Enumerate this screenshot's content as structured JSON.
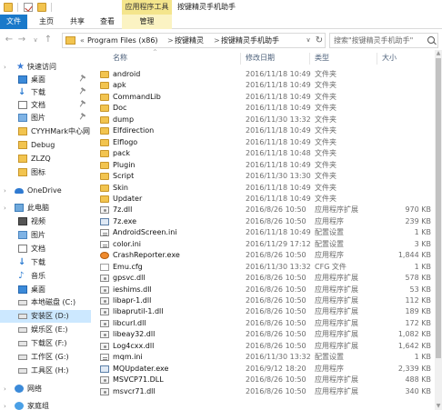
{
  "titlebar": {
    "context_tab": "应用程序工具",
    "title": "按键精灵手机助手"
  },
  "ribbon": {
    "tabs": [
      "文件",
      "主页",
      "共享",
      "查看",
      "管理"
    ]
  },
  "address": {
    "overflow": "«",
    "crumbs": [
      "Program Files (x86)",
      "按键精灵",
      "按键精灵手机助手"
    ],
    "separator": ">",
    "search_placeholder": "搜索\"按键精灵手机助手\""
  },
  "nav": {
    "items": [
      {
        "label": "快速访问",
        "icon": "star-icon",
        "pinned": false
      },
      {
        "label": "桌面",
        "icon": "desktop-icon",
        "pinned": true
      },
      {
        "label": "下载",
        "icon": "download-icon",
        "pinned": true
      },
      {
        "label": "文档",
        "icon": "documents-icon",
        "pinned": true
      },
      {
        "label": "图片",
        "icon": "pictures-icon",
        "pinned": true
      },
      {
        "label": "CYYHMark中心网",
        "icon": "folder-icon",
        "pinned": false
      },
      {
        "label": "Debug",
        "icon": "folder-icon",
        "pinned": false
      },
      {
        "label": "ZLZQ",
        "icon": "folder-icon",
        "pinned": false
      },
      {
        "label": "图标",
        "icon": "folder-icon",
        "pinned": false
      },
      {
        "label": "OneDrive",
        "icon": "cloud-icon",
        "pinned": false
      },
      {
        "label": "此电脑",
        "icon": "computer-icon",
        "pinned": false
      },
      {
        "label": "视频",
        "icon": "video-icon",
        "pinned": false
      },
      {
        "label": "图片",
        "icon": "pictures-icon",
        "pinned": false
      },
      {
        "label": "文档",
        "icon": "documents-icon",
        "pinned": false
      },
      {
        "label": "下载",
        "icon": "download-icon",
        "pinned": false
      },
      {
        "label": "音乐",
        "icon": "music-icon",
        "pinned": false
      },
      {
        "label": "桌面",
        "icon": "desktop-icon",
        "pinned": false
      },
      {
        "label": "本地磁盘 (C:)",
        "icon": "drive-icon",
        "pinned": false
      },
      {
        "label": "安装区 (D:)",
        "icon": "drive-icon",
        "pinned": false,
        "selected": true
      },
      {
        "label": "娱乐区 (E:)",
        "icon": "drive-icon",
        "pinned": false
      },
      {
        "label": "下载区 (F:)",
        "icon": "drive-icon",
        "pinned": false
      },
      {
        "label": "工作区 (G:)",
        "icon": "drive-icon",
        "pinned": false
      },
      {
        "label": "工具区 (H:)",
        "icon": "drive-icon",
        "pinned": false
      },
      {
        "label": "网络",
        "icon": "network-icon",
        "pinned": false
      },
      {
        "label": "家庭组",
        "icon": "homegroup-icon",
        "pinned": false
      }
    ]
  },
  "filelist": {
    "columns": {
      "name": "名称",
      "date": "修改日期",
      "type": "类型",
      "size": "大小"
    },
    "sort_indicator": "^",
    "rows": [
      {
        "name": "android",
        "date": "2016/11/18 10:49",
        "type": "文件夹",
        "size": "",
        "kind": "folder"
      },
      {
        "name": "apk",
        "date": "2016/11/18 10:49",
        "type": "文件夹",
        "size": "",
        "kind": "folder"
      },
      {
        "name": "CommandLib",
        "date": "2016/11/18 10:49",
        "type": "文件夹",
        "size": "",
        "kind": "folder"
      },
      {
        "name": "Doc",
        "date": "2016/11/18 10:49",
        "type": "文件夹",
        "size": "",
        "kind": "folder"
      },
      {
        "name": "dump",
        "date": "2016/11/30 13:32",
        "type": "文件夹",
        "size": "",
        "kind": "folder"
      },
      {
        "name": "Elfdirection",
        "date": "2016/11/18 10:49",
        "type": "文件夹",
        "size": "",
        "kind": "folder"
      },
      {
        "name": "Elflogo",
        "date": "2016/11/18 10:49",
        "type": "文件夹",
        "size": "",
        "kind": "folder"
      },
      {
        "name": "pack",
        "date": "2016/11/18 10:48",
        "type": "文件夹",
        "size": "",
        "kind": "folder"
      },
      {
        "name": "Plugin",
        "date": "2016/11/18 10:49",
        "type": "文件夹",
        "size": "",
        "kind": "folder"
      },
      {
        "name": "Script",
        "date": "2016/11/30 13:30",
        "type": "文件夹",
        "size": "",
        "kind": "folder"
      },
      {
        "name": "Skin",
        "date": "2016/11/18 10:49",
        "type": "文件夹",
        "size": "",
        "kind": "folder"
      },
      {
        "name": "Updater",
        "date": "2016/11/18 10:49",
        "type": "文件夹",
        "size": "",
        "kind": "folder"
      },
      {
        "name": "7z.dll",
        "date": "2016/8/26 10:50",
        "type": "应用程序扩展",
        "size": "970 KB",
        "kind": "dll"
      },
      {
        "name": "7z.exe",
        "date": "2016/8/26 10:50",
        "type": "应用程序",
        "size": "239 KB",
        "kind": "exe"
      },
      {
        "name": "AndroidScreen.ini",
        "date": "2016/11/18 10:49",
        "type": "配置设置",
        "size": "1 KB",
        "kind": "ini"
      },
      {
        "name": "color.ini",
        "date": "2016/11/29 17:12",
        "type": "配置设置",
        "size": "3 KB",
        "kind": "ini"
      },
      {
        "name": "CrashReporter.exe",
        "date": "2016/8/26 10:50",
        "type": "应用程序",
        "size": "1,844 KB",
        "kind": "exe-color"
      },
      {
        "name": "Emu.cfg",
        "date": "2016/11/30 13:32",
        "type": "CFG 文件",
        "size": "1 KB",
        "kind": "cfg"
      },
      {
        "name": "gpsvc.dll",
        "date": "2016/8/26 10:50",
        "type": "应用程序扩展",
        "size": "578 KB",
        "kind": "dll"
      },
      {
        "name": "ieshims.dll",
        "date": "2016/8/26 10:50",
        "type": "应用程序扩展",
        "size": "53 KB",
        "kind": "dll"
      },
      {
        "name": "libapr-1.dll",
        "date": "2016/8/26 10:50",
        "type": "应用程序扩展",
        "size": "112 KB",
        "kind": "dll"
      },
      {
        "name": "libaprutil-1.dll",
        "date": "2016/8/26 10:50",
        "type": "应用程序扩展",
        "size": "189 KB",
        "kind": "dll"
      },
      {
        "name": "libcurl.dll",
        "date": "2016/8/26 10:50",
        "type": "应用程序扩展",
        "size": "172 KB",
        "kind": "dll"
      },
      {
        "name": "libeay32.dll",
        "date": "2016/8/26 10:50",
        "type": "应用程序扩展",
        "size": "1,082 KB",
        "kind": "dll"
      },
      {
        "name": "Log4cxx.dll",
        "date": "2016/8/26 10:50",
        "type": "应用程序扩展",
        "size": "1,642 KB",
        "kind": "dll"
      },
      {
        "name": "mqm.ini",
        "date": "2016/11/30 13:32",
        "type": "配置设置",
        "size": "1 KB",
        "kind": "ini"
      },
      {
        "name": "MQUpdater.exe",
        "date": "2016/9/12 18:20",
        "type": "应用程序",
        "size": "2,339 KB",
        "kind": "exe"
      },
      {
        "name": "MSVCP71.DLL",
        "date": "2016/8/26 10:50",
        "type": "应用程序扩展",
        "size": "488 KB",
        "kind": "dll"
      },
      {
        "name": "msvcr71.dll",
        "date": "2016/8/26 10:50",
        "type": "应用程序扩展",
        "size": "340 KB",
        "kind": "dll"
      }
    ]
  }
}
